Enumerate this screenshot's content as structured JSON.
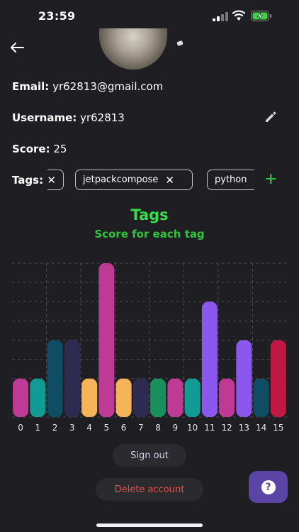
{
  "status_bar": {
    "time": "23:59"
  },
  "profile": {
    "email_label": "Email:",
    "email": "yr62813@gmail.com",
    "username_label": "Username:",
    "username": "yr62813",
    "score_label": "Score:",
    "score": "25",
    "tags_label": "Tags:"
  },
  "tags": {
    "chips": [
      "",
      "jetpackcompose",
      "python"
    ],
    "remove_glyph": "✕",
    "add_glyph": "+"
  },
  "icons": {
    "back": "arrow-back-icon",
    "edit": "pencil-icon",
    "help": "question-icon"
  },
  "chart_data": {
    "type": "bar",
    "title": "Tags",
    "subtitle": "Score for each tag",
    "categories": [
      "0",
      "1",
      "2",
      "3",
      "4",
      "5",
      "6",
      "7",
      "8",
      "9",
      "10",
      "11",
      "12",
      "13",
      "14",
      "15"
    ],
    "values": [
      1,
      1,
      2,
      2,
      1,
      4,
      1,
      1,
      1,
      1,
      1,
      3,
      1,
      2,
      1,
      2
    ],
    "colors": [
      "#be3a95",
      "#109b95",
      "#0e4d63",
      "#2e2b52",
      "#f7b357",
      "#be3a95",
      "#f7b357",
      "#2e2b52",
      "#17905e",
      "#be3a95",
      "#109b95",
      "#8b57ee",
      "#be3a95",
      "#8b57ee",
      "#0e4d63",
      "#bf1845"
    ],
    "ylim": [
      0,
      4
    ],
    "grid": true
  },
  "actions": {
    "sign_out": "Sign out",
    "delete_account": "Delete account",
    "help": "?"
  },
  "colors": {
    "background": "#1f1e22",
    "accent_green": "#35e04c",
    "danger": "#e8524a",
    "help_button": "#5a44a6"
  }
}
